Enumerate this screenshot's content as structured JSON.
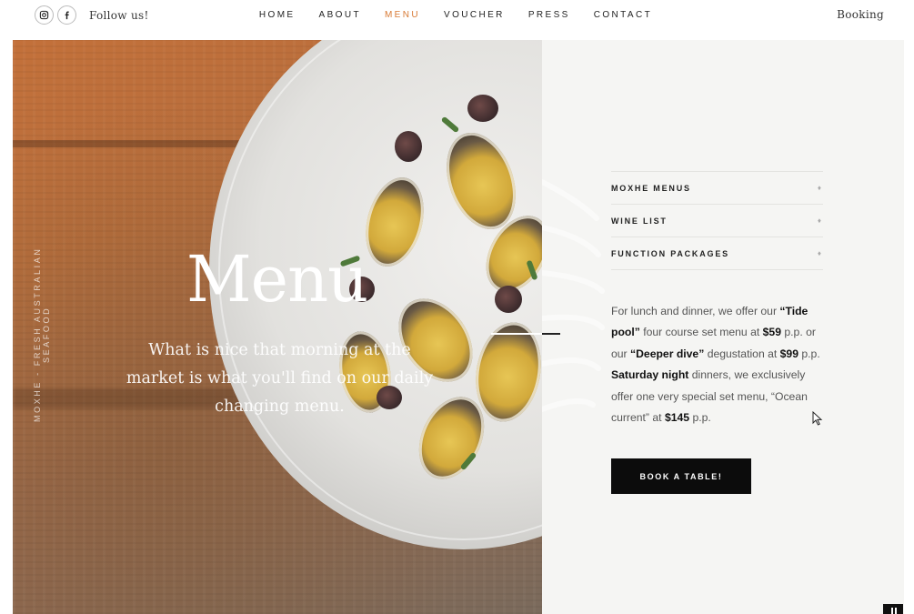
{
  "header": {
    "social": {
      "instagram_icon": "instagram-icon",
      "facebook_icon": "facebook-icon",
      "follow_label": "Follow us!"
    },
    "nav": [
      {
        "label": "HOME",
        "active": false
      },
      {
        "label": "ABOUT",
        "active": false
      },
      {
        "label": "MENU",
        "active": true
      },
      {
        "label": "VOUCHER",
        "active": false
      },
      {
        "label": "PRESS",
        "active": false
      },
      {
        "label": "CONTACT",
        "active": false
      }
    ],
    "booking_label": "Booking"
  },
  "hero": {
    "vertical_text": "MOXHE - FRESH AUSTRALIAN SEAFOOD",
    "title": "Menu",
    "description": "What is nice that morning at the market is what you'll find on our daily changing menu."
  },
  "panel": {
    "menu_items": [
      {
        "label": "MOXHE MENUS",
        "icon": "plus-small-icon"
      },
      {
        "label": "WINE LIST",
        "icon": "plus-small-icon"
      },
      {
        "label": "FUNCTION PACKAGES",
        "icon": "plus-small-icon"
      }
    ],
    "copy": {
      "p1": "For lunch and dinner, we offer our ",
      "b1": "“Tide pool”",
      "p2": " four course set menu at ",
      "b2": "$59",
      "p3": " p.p. or our ",
      "b3": "“Deeper dive”",
      "p4": " degustation at ",
      "b4": "$99",
      "p5": " p.p. ",
      "b5": "Saturday night",
      "p6": " dinners, we exclusively offer one very special set menu, “Ocean current” at ",
      "b6": "$145",
      "p7": " p.p."
    },
    "book_button": "BOOK A TABLE!"
  },
  "colors": {
    "accent": "#d87a35",
    "panel_bg": "#f5f5f3",
    "button_bg": "#0c0c0c"
  }
}
